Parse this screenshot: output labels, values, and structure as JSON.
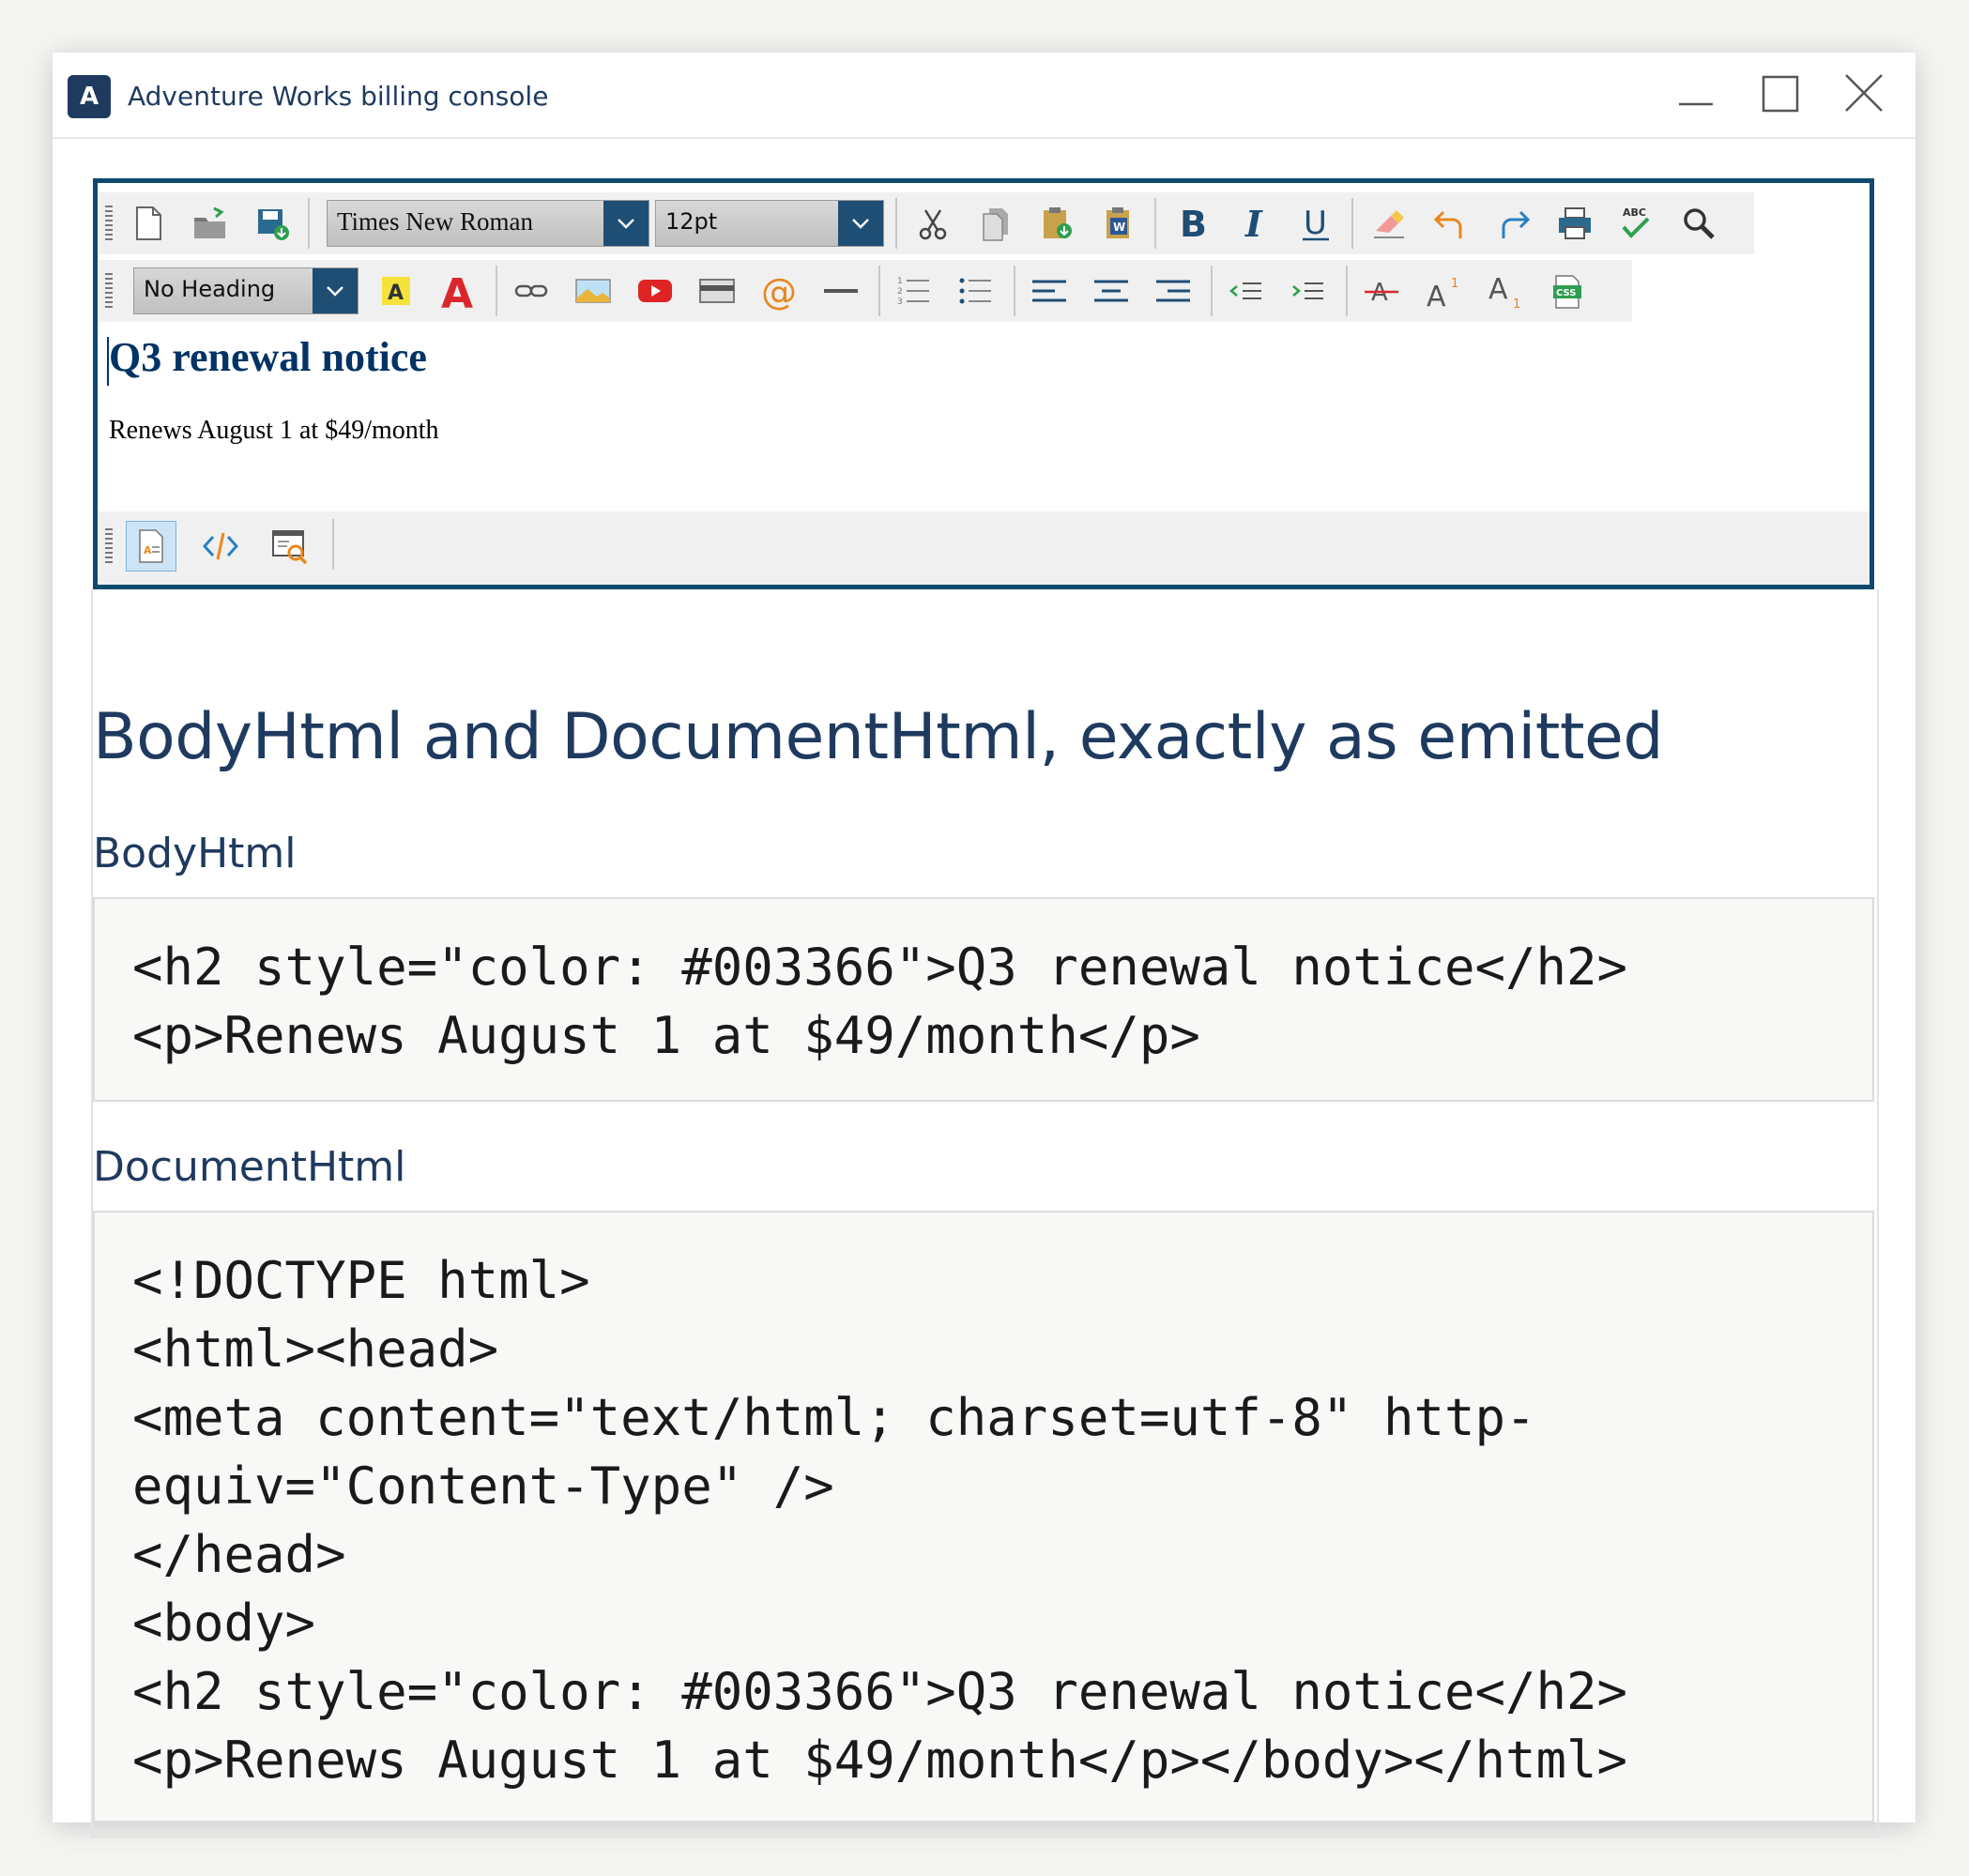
{
  "window": {
    "icon_letter": "A",
    "title": "Adventure Works billing console"
  },
  "toolbar": {
    "font_family": "Times New Roman",
    "font_size": "12pt",
    "heading_style": "No Heading",
    "row1_icons": [
      "new-document-icon",
      "open-folder-icon",
      "save-icon",
      "cut-icon",
      "copy-icon",
      "paste-icon",
      "paste-from-word-icon",
      "bold-icon",
      "italic-icon",
      "underline-icon",
      "eraser-icon",
      "undo-icon",
      "redo-icon",
      "print-icon",
      "spell-check-icon",
      "find-icon"
    ],
    "row2_icons": [
      "highlight-color-icon",
      "font-color-icon",
      "link-icon",
      "image-icon",
      "video-icon",
      "table-icon",
      "email-link-icon",
      "horizontal-rule-icon",
      "numbered-list-icon",
      "bulleted-list-icon",
      "align-left-icon",
      "align-center-icon",
      "align-right-icon",
      "outdent-icon",
      "indent-icon",
      "strikethrough-icon",
      "superscript-icon",
      "subscript-icon",
      "css-icon"
    ]
  },
  "editor": {
    "heading": "Q3 renewal notice",
    "paragraph": "Renews August 1 at $49/month",
    "heading_color": "#003366"
  },
  "view_modes": [
    "design-view-icon",
    "html-source-view-icon",
    "preview-view-icon"
  ],
  "page": {
    "title": "BodyHtml and DocumentHtml, exactly as emitted",
    "body_section_title": "BodyHtml",
    "document_section_title": "DocumentHtml",
    "body_html_lines": [
      "<h2 style=\"color: #003366\">Q3 renewal notice</h2>",
      "<p>Renews August 1 at $49/month</p>"
    ],
    "document_html_lines": [
      "<!DOCTYPE html>",
      "<html><head>",
      "<meta content=\"text/html; charset=utf-8\" http-",
      "equiv=\"Content-Type\" />",
      "</head>",
      "<body>",
      "<h2 style=\"color: #003366\">Q3 renewal notice</h2>",
      "<p>Renews August 1 at $49/month</p></body></html>"
    ]
  },
  "colors": {
    "accent": "#1f3a5f",
    "editor_border": "#0f4a6e",
    "combo_arrow": "#1f4e75"
  }
}
